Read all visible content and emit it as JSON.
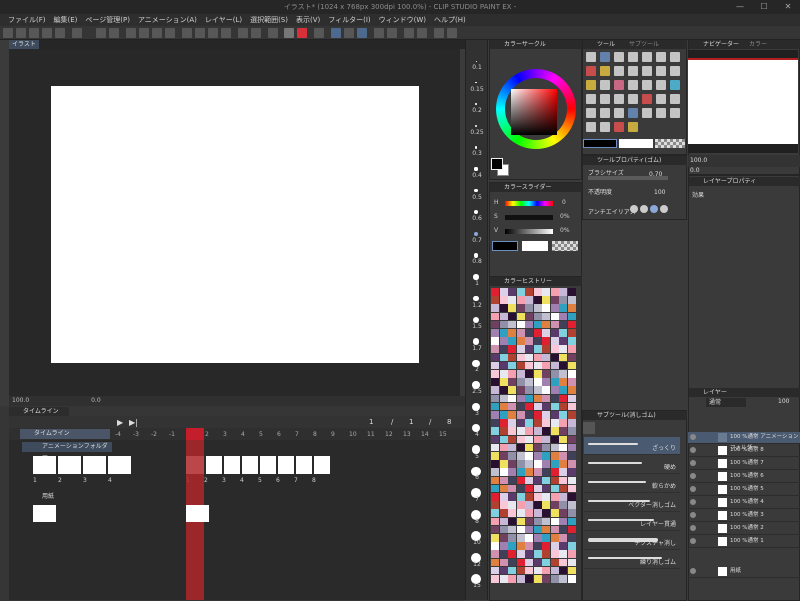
{
  "window": {
    "title": "イラスト* (1024 x 768px 300dpi 100.0%)  - CLIP STUDIO PAINT EX -"
  },
  "window_controls": {
    "minimize": "—",
    "maximize": "☐",
    "close": "✕"
  },
  "menu": [
    "ファイル(F)",
    "編集(E)",
    "ページ管理(P)",
    "アニメーション(A)",
    "レイヤー(L)",
    "選択範囲(S)",
    "表示(V)",
    "フィルター(I)",
    "ウィンドウ(W)",
    "ヘルプ(H)"
  ],
  "canvas": {
    "tab": "イラスト",
    "zoom": "100.0",
    "angle": "0.0"
  },
  "brush_sizes": [
    "0.1",
    "0.15",
    "0.2",
    "0.25",
    "0.3",
    "0.4",
    "0.5",
    "0.6",
    "0.7",
    "0.8",
    "1",
    "1.2",
    "1.5",
    "1.7",
    "2",
    "2.5",
    "3",
    "4",
    "5",
    "6",
    "7",
    "8",
    "10",
    "12",
    "15"
  ],
  "timeline": {
    "tab": "タイムライン",
    "name": "タイムライン",
    "frame_fields": [
      "1",
      "/",
      "1",
      "/",
      "8"
    ],
    "ruler": [
      "-4",
      "-3",
      "-2",
      "-1",
      "1",
      "2",
      "3",
      "4",
      "5",
      "6",
      "7",
      "8",
      "9",
      "10",
      "11",
      "12",
      "13",
      "14",
      "15"
    ],
    "track_folder": "アニメーションフォルダー",
    "track_paper": "用紙",
    "cell_numbers": [
      "1",
      "2",
      "3",
      "4",
      "1",
      "2",
      "3",
      "4",
      "5",
      "6",
      "7",
      "8"
    ]
  },
  "color_wheel": {
    "tab": "カラーサークル",
    "fg": "#000000",
    "bg": "#ffffff"
  },
  "color_slider": {
    "tab": "カラースライダー",
    "rows": [
      {
        "label": "H",
        "value": "0"
      },
      {
        "label": "S",
        "value": "0%"
      },
      {
        "label": "V",
        "value": "0%"
      }
    ]
  },
  "color_history": {
    "tab": "カラーヒストリー"
  },
  "tool": {
    "tab": "ツール",
    "tab2": "サブツール"
  },
  "tool_property": {
    "tab": "ツールプロパティ(ゴム)",
    "brush_size_label": "ブラシサイズ",
    "brush_size": "0.70",
    "opacity_label": "不透明度",
    "opacity": "100",
    "aa_label": "アンチエイリアス"
  },
  "sub_tool": {
    "tab": "サブツール(消しゴム)",
    "items": [
      "ざっくり",
      "硬め",
      "軟らかめ",
      "ベクター消しゴム",
      "レイヤー貫通",
      "テクスチャ消し",
      "練り消しゴム"
    ]
  },
  "navigator": {
    "tab": "ナビゲーター",
    "tab2": "カラー",
    "zoom": "100.0",
    "angle": "0.0"
  },
  "layer_property": {
    "tab": "レイヤープロパティ",
    "effect_label": "効果"
  },
  "layers": {
    "tab": "レイヤー",
    "blend": "通常",
    "opacity": "100",
    "items": [
      {
        "name": "100 %通常\nアニメーションフォルダー",
        "level": 0
      },
      {
        "name": "100 %通常 8",
        "level": 1
      },
      {
        "name": "100 %通常 7",
        "level": 1
      },
      {
        "name": "100 %通常 6",
        "level": 1
      },
      {
        "name": "100 %通常 5",
        "level": 1
      },
      {
        "name": "100 %通常 4",
        "level": 1
      },
      {
        "name": "100 %通常 3",
        "level": 1
      },
      {
        "name": "100 %通常 2",
        "level": 1
      },
      {
        "name": "100 %通常 1",
        "level": 1
      },
      {
        "name": "用紙",
        "level": 0
      }
    ]
  }
}
